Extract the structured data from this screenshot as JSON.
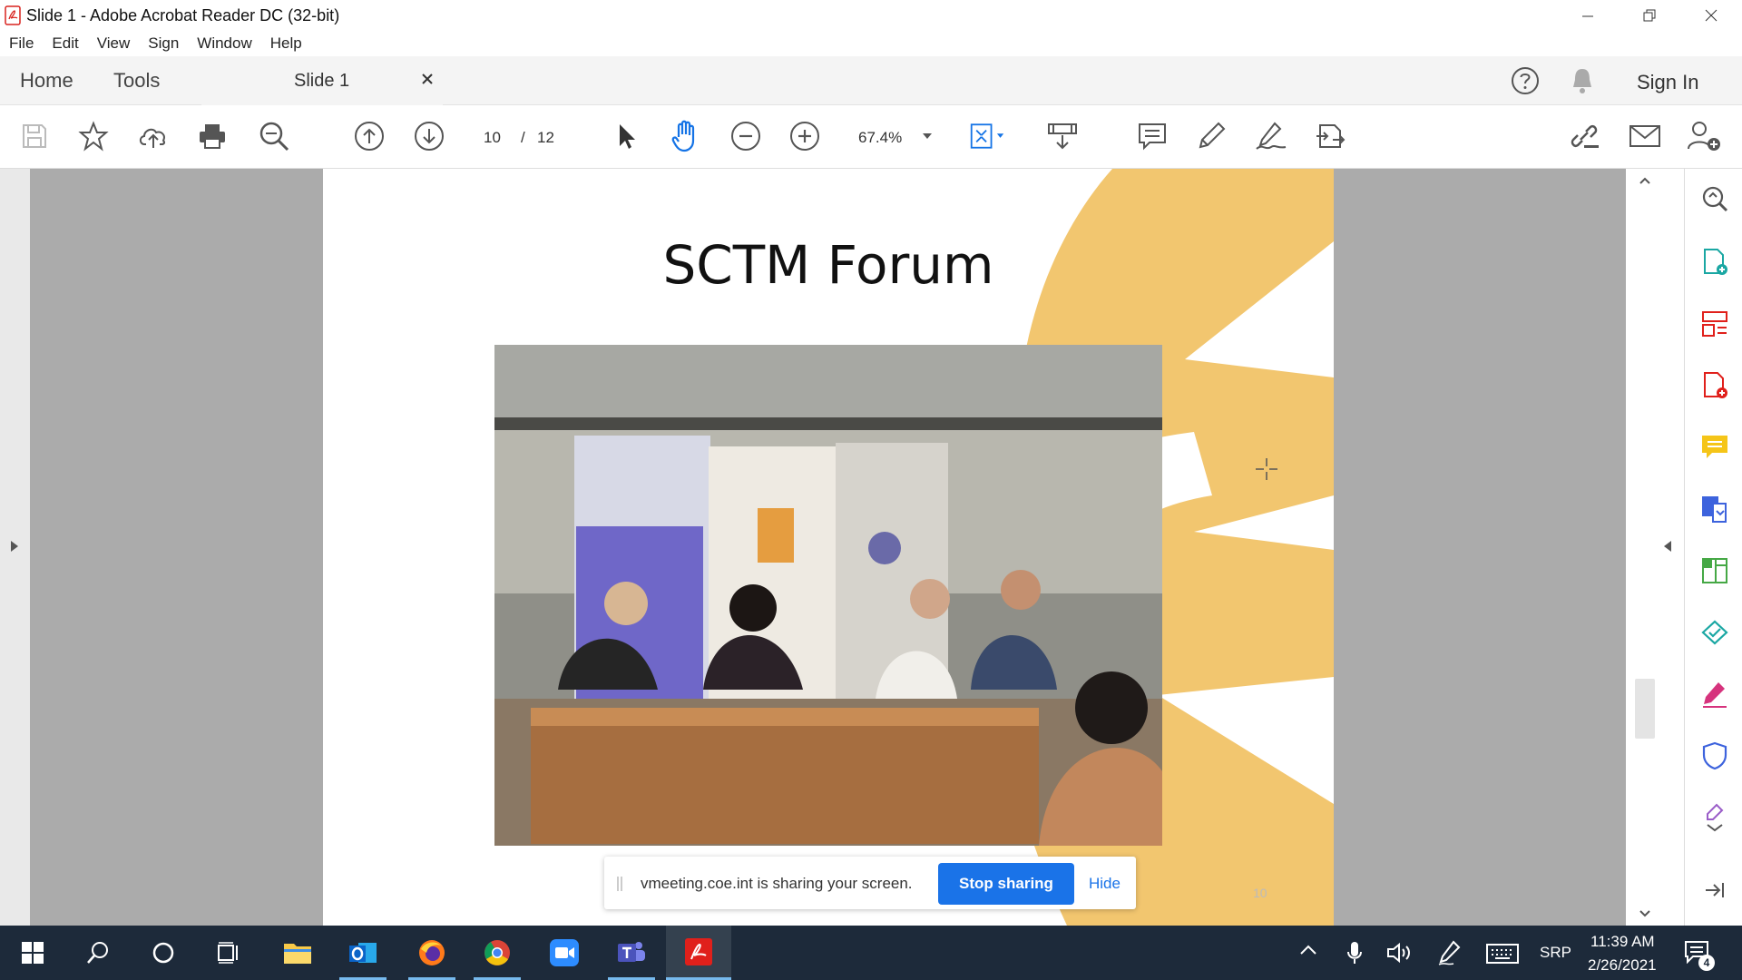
{
  "window": {
    "title": "Slide 1 - Adobe Acrobat Reader DC (32-bit)"
  },
  "menu": [
    "File",
    "Edit",
    "View",
    "Sign",
    "Window",
    "Help"
  ],
  "tabs": {
    "home": "Home",
    "tools": "Tools",
    "document": "Slide 1",
    "close": "×",
    "sign_in": "Sign In"
  },
  "toolbar": {
    "current_page": "10",
    "page_separator": "/",
    "total_pages": "12",
    "zoom": "67.4%"
  },
  "slide": {
    "title": "SCTM Forum",
    "page_number": "10"
  },
  "share_banner": {
    "message": "vmeeting.coe.int is sharing your screen.",
    "stop_label": "Stop sharing",
    "hide_label": "Hide"
  },
  "tray": {
    "language": "SRP",
    "time": "11:39 AM",
    "date": "2/26/2021",
    "notification_count": "4"
  },
  "colors": {
    "accent_blue": "#1a73e8",
    "acrobat_red": "#e0201b",
    "taskbar": "#1d2a3a",
    "slide_gold": "#f2c66f"
  }
}
